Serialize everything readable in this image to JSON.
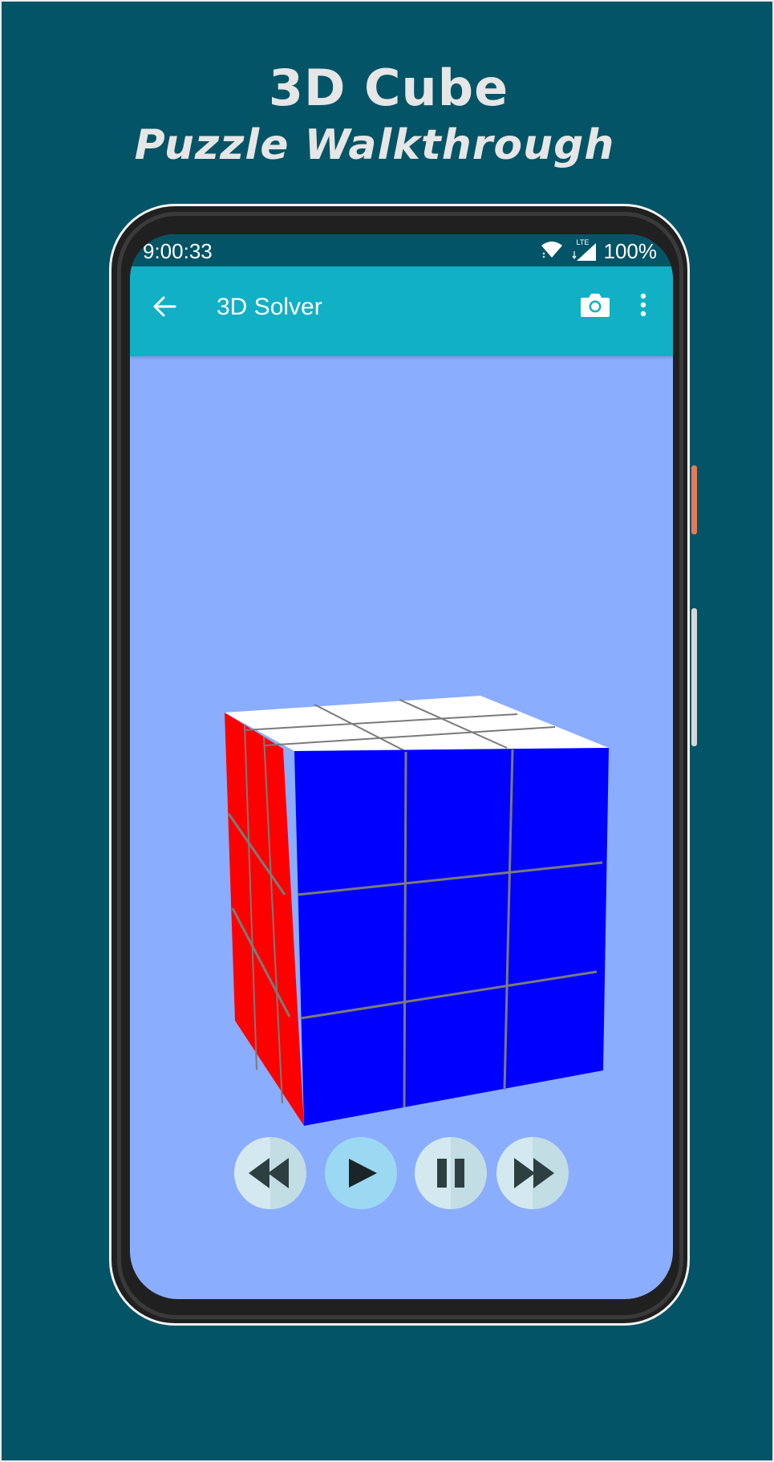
{
  "promo": {
    "title": "3D Cube",
    "subtitle": "Puzzle Walkthrough"
  },
  "status_bar": {
    "time": "9:00:33",
    "network": "LTE",
    "battery": "100%",
    "icons": [
      "wifi-icon",
      "cell-signal-icon"
    ]
  },
  "app_bar": {
    "title": "3D Solver",
    "back_icon": "arrow-left-icon",
    "camera_icon": "camera-icon",
    "menu_icon": "more-vert-icon"
  },
  "cube": {
    "front_face_color": "#0000ff",
    "side_face_color": "#ff0000",
    "top_face_color": "#ffffff"
  },
  "controls": [
    {
      "name": "rewind-button",
      "icon": "rewind-icon"
    },
    {
      "name": "play-button",
      "icon": "play-icon"
    },
    {
      "name": "pause-button",
      "icon": "pause-icon"
    },
    {
      "name": "fast-forward-button",
      "icon": "fast-forward-icon"
    }
  ],
  "colors": {
    "background": "#035466",
    "app_bar": "#11b0c5",
    "canvas": "#8badfd",
    "cube_blue": "#0000ff",
    "cube_red": "#ff0000",
    "grid_line": "#7a7a7a"
  }
}
